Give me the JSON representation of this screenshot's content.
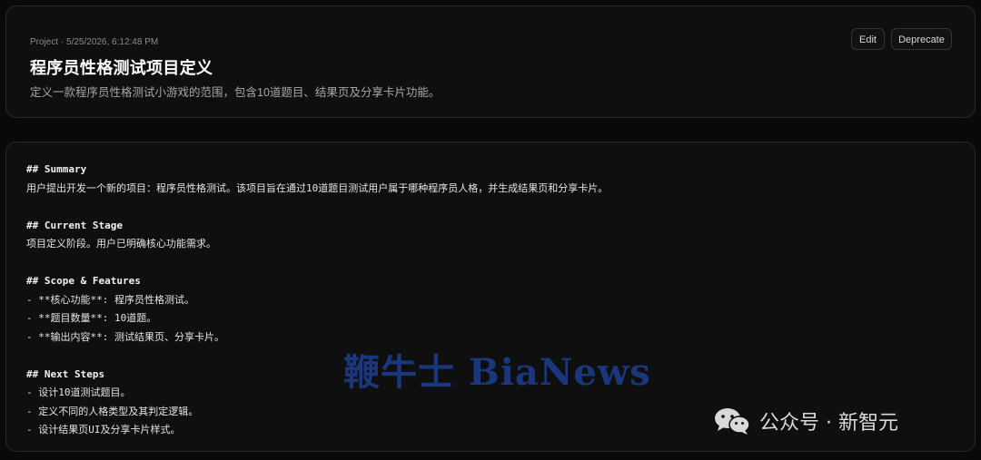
{
  "header": {
    "meta": "Project · 5/25/2026, 6:12:48 PM",
    "title": "程序员性格测试项目定义",
    "description": "定义一款程序员性格测试小游戏的范围，包含10道题目、结果页及分享卡片功能。",
    "edit_label": "Edit",
    "deprecate_label": "Deprecate"
  },
  "content": {
    "lines": [
      "## Summary",
      "用户提出开发一个新的项目：程序员性格测试。该项目旨在通过10道题目测试用户属于哪种程序员人格，并生成结果页和分享卡片。",
      "",
      "## Current Stage",
      "项目定义阶段。用户已明确核心功能需求。",
      "",
      "## Scope & Features",
      "- **核心功能**: 程序员性格测试。",
      "- **题目数量**: 10道题。",
      "- **输出内容**: 测试结果页、分享卡片。",
      "",
      "## Next Steps",
      "- 设计10道测试题目。",
      "- 定义不同的人格类型及其判定逻辑。",
      "- 设计结果页UI及分享卡片样式。"
    ]
  },
  "watermarks": {
    "center": "鞭牛士 BiaNews",
    "corner": "公众号 · 新智元"
  },
  "colors": {
    "background": "#090909",
    "card": "#0f0f0f",
    "border": "#262626",
    "watermark_blue": "#1d3d8f"
  }
}
